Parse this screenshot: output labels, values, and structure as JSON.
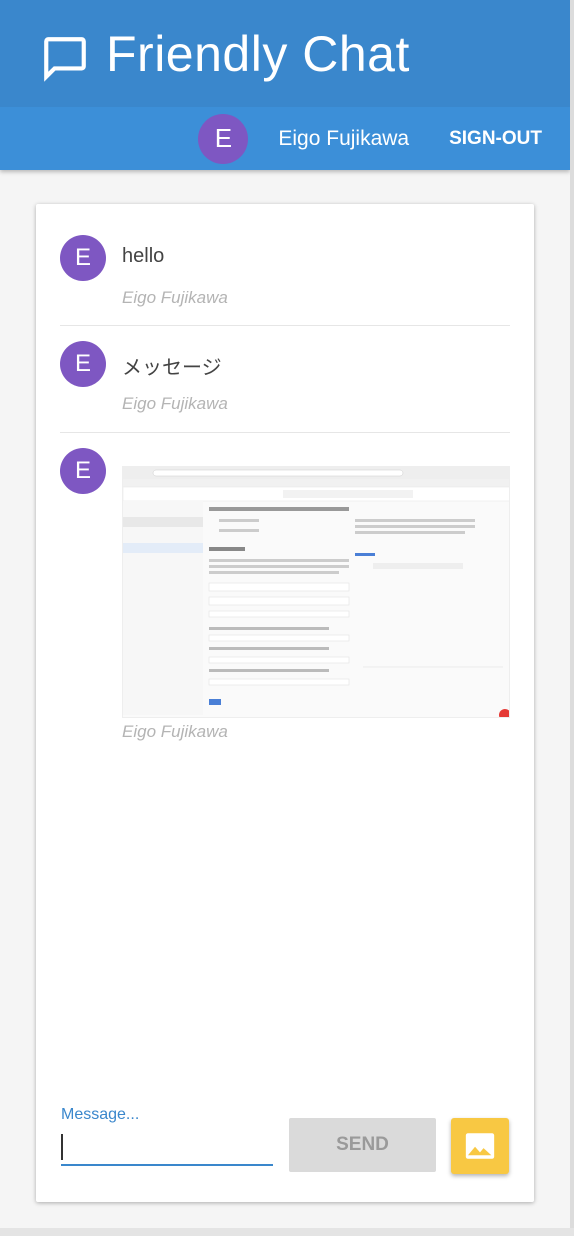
{
  "header": {
    "title": "Friendly Chat",
    "user_initial": "E",
    "user_name": "Eigo Fujikawa",
    "signout_label": "SIGN-OUT"
  },
  "messages": [
    {
      "initial": "E",
      "text": "hello",
      "author": "Eigo Fujikawa"
    },
    {
      "initial": "E",
      "text": "メッセージ",
      "author": "Eigo Fujikawa"
    },
    {
      "initial": "E",
      "image_description": "browser-screenshot-image",
      "author": "Eigo Fujikawa"
    }
  ],
  "composer": {
    "label": "Message...",
    "value": "",
    "send_label": "SEND",
    "image_button_icon": "image-icon"
  },
  "colors": {
    "header_top": "#3a87cc",
    "header_bottom": "#3c8fd8",
    "avatar": "#7e57c2",
    "accent": "#3a87cc",
    "image_button": "#f8c843"
  }
}
